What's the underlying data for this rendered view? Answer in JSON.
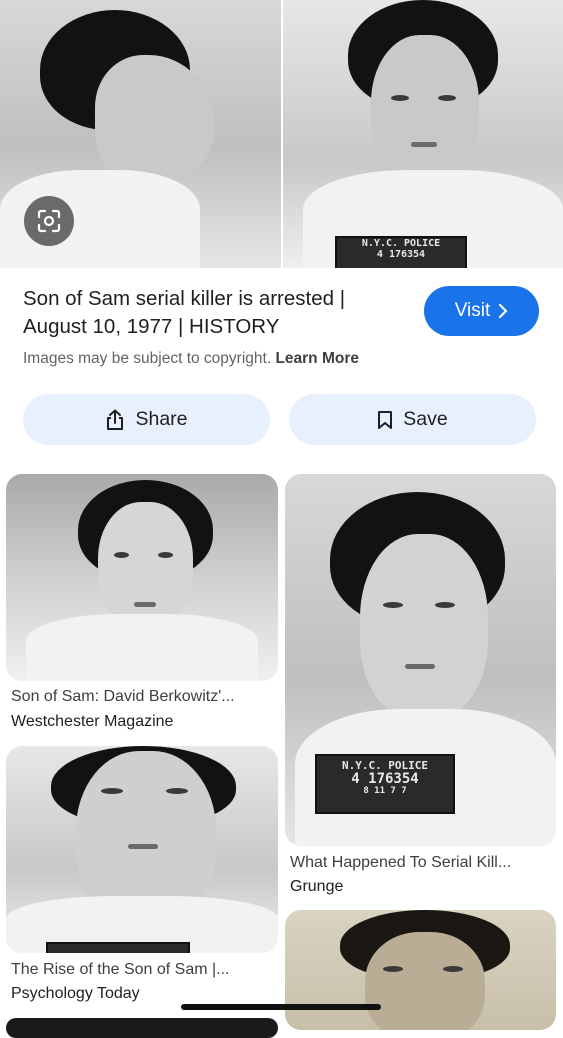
{
  "hero": {
    "left_alt": "profile mugshot",
    "right_alt": "front mugshot",
    "plate_line1": "N.Y.C. POLICE",
    "plate_line2": "4 176354"
  },
  "result": {
    "title": "Son of Sam serial killer is arrested | August 10, 1977 | HISTORY",
    "visit_label": "Visit",
    "notice_text": "Images may be subject to copyright.",
    "learn_more": "Learn More",
    "share_label": "Share",
    "save_label": "Save"
  },
  "related": [
    {
      "title": "Son of Sam: David Berkowitz'...",
      "source": "Westchester Magazine"
    },
    {
      "title": "What Happened To Serial Kill...",
      "source": "Grunge",
      "plate_line1": "N.Y.C. POLICE",
      "plate_line2": "4 176354",
      "plate_line3": "8 11 7 7"
    },
    {
      "title": "The Rise of the Son of Sam |...",
      "source": "Psychology Today"
    }
  ],
  "colors": {
    "accent": "#1a73e8",
    "pill_bg": "#e8f0fe",
    "muted_text": "#5f6368"
  },
  "icons": [
    "lens-icon",
    "chevron-right-icon",
    "share-icon",
    "bookmark-icon"
  ]
}
